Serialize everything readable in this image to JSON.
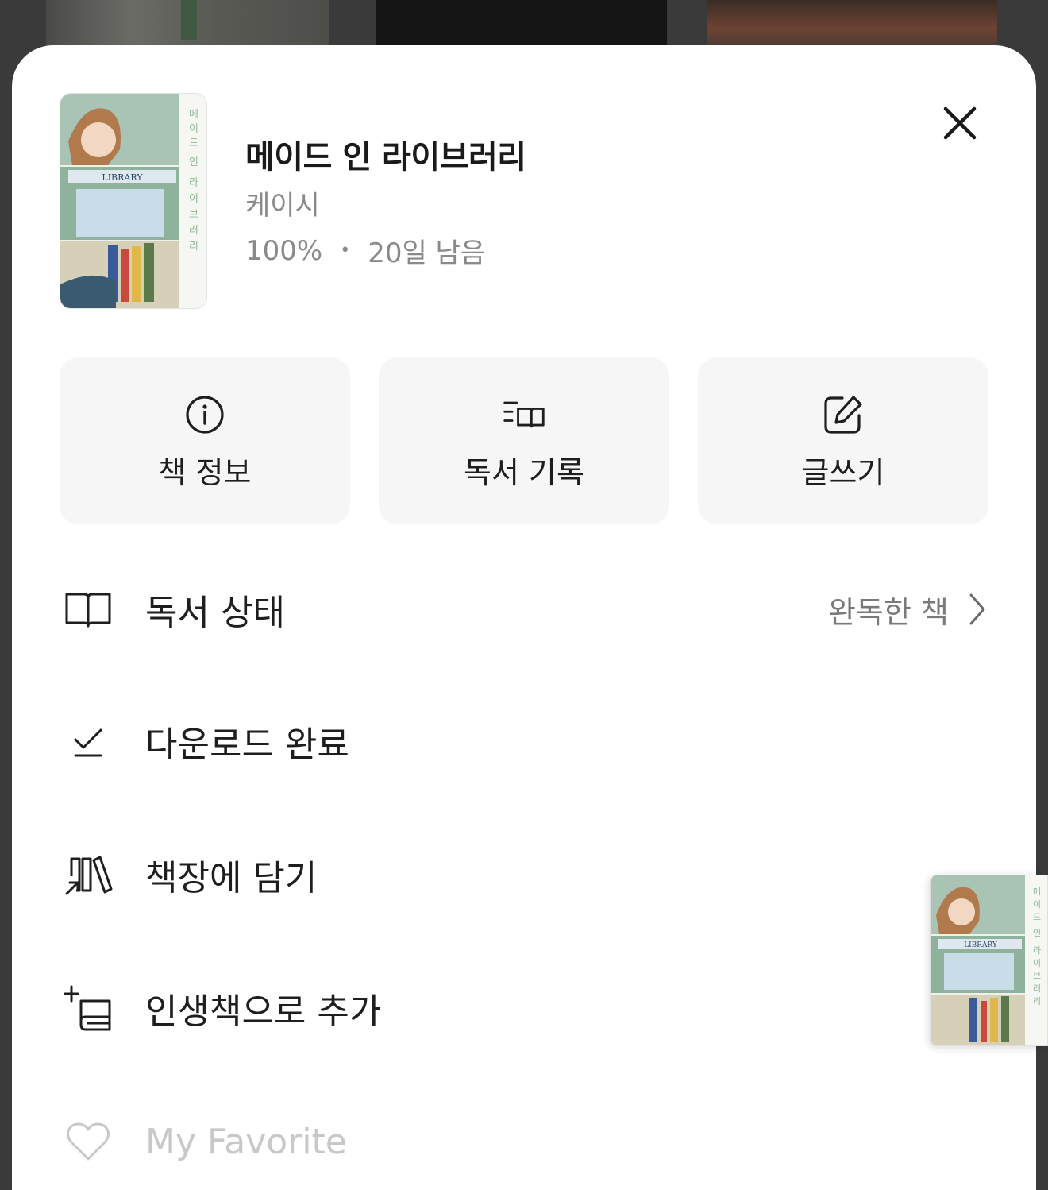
{
  "book": {
    "title": "메이드 인 라이브러리",
    "author": "케이시",
    "progress": "100%",
    "separator": "•",
    "remaining": "20일 남음",
    "cover_library_text": "LIBRARY"
  },
  "actions": [
    {
      "label": "책 정보",
      "icon": "info-icon"
    },
    {
      "label": "독서 기록",
      "icon": "reading-log-icon"
    },
    {
      "label": "글쓰기",
      "icon": "edit-icon"
    }
  ],
  "menu": {
    "reading_status": {
      "label": "독서 상태",
      "value": "완독한 책",
      "icon": "open-book-icon"
    },
    "download": {
      "label": "다운로드 완료",
      "icon": "download-done-icon"
    },
    "bookshelf": {
      "label": "책장에 담기",
      "icon": "bookshelf-add-icon"
    },
    "life_book": {
      "label": "인생책으로 추가",
      "icon": "book-plus-icon"
    },
    "favorite": {
      "label": "My Favorite",
      "icon": "heart-icon"
    }
  },
  "colors": {
    "sheet_bg": "#ffffff",
    "button_bg": "#f6f6f6",
    "text_primary": "#1e1e1e",
    "text_secondary": "#8a8a8a",
    "overlay": "#3a3a3a"
  }
}
